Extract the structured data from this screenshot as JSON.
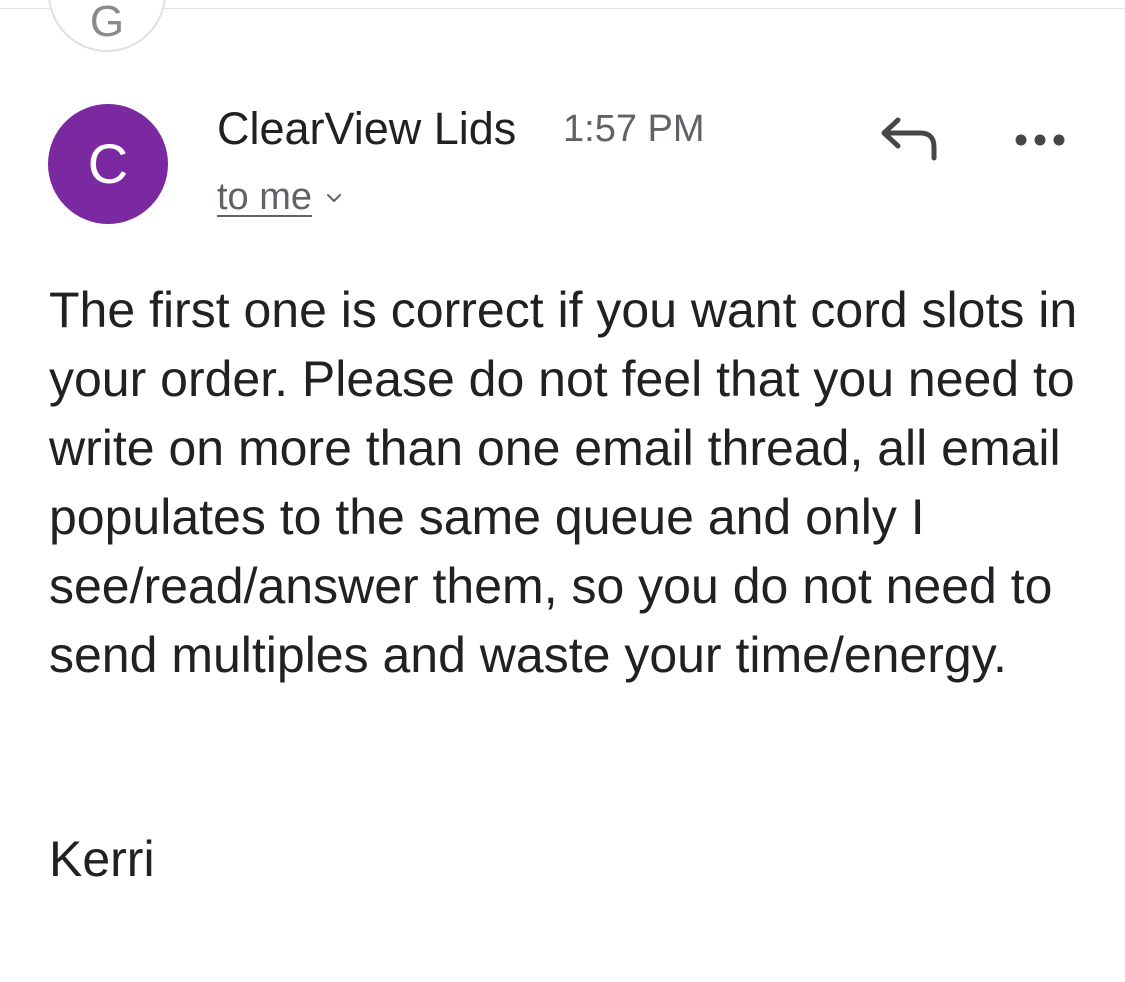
{
  "previous_message": {
    "avatar_letter": "G"
  },
  "message": {
    "sender": {
      "avatar_letter": "C",
      "avatar_color": "#7b29a0",
      "name": "ClearView Lids"
    },
    "time": "1:57 PM",
    "recipient_label": "to me",
    "actions": {
      "reply_icon": "reply-arrow",
      "more_icon": "horizontal-ellipsis"
    },
    "body": "The first one is correct if you want cord slots in your order. Please do not feel that you need to write on more than one email thread, all email populates to the same queue and only I see/read/answer them, so you do not need to send multiples and waste your time/energy.",
    "signature": "Kerri"
  }
}
